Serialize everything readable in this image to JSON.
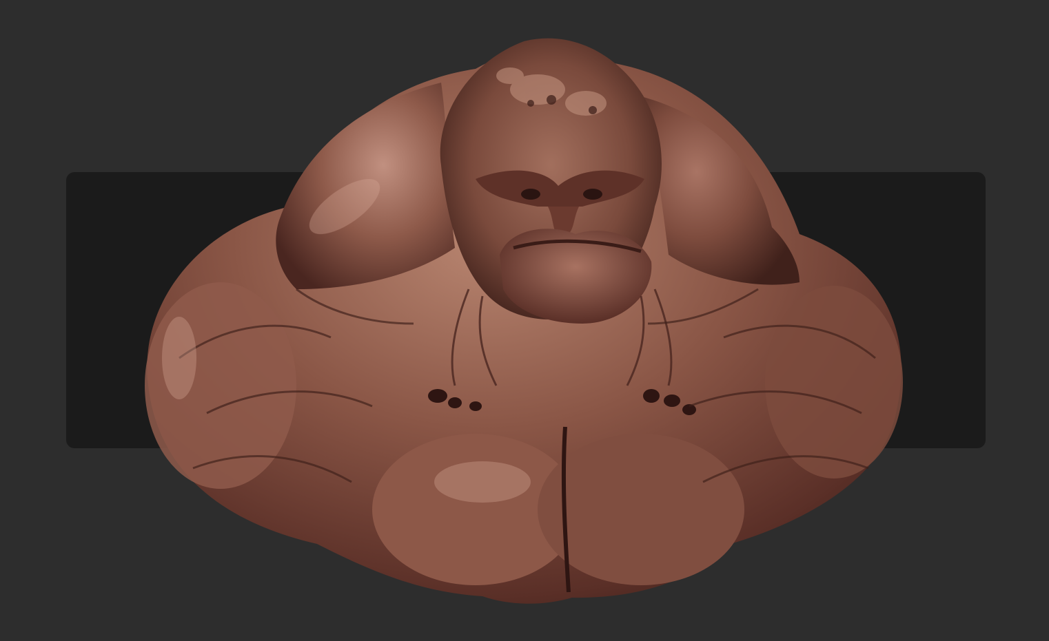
{
  "scene": {
    "background_color": "#2d2d2d",
    "panel_color": "#1b1b1b",
    "subject": "creature-bust-sculpt",
    "material_colors": {
      "skin_light": "#b88570",
      "skin_mid": "#8a5646",
      "skin_dark": "#4a2620",
      "crevice": "#2e1512"
    }
  }
}
